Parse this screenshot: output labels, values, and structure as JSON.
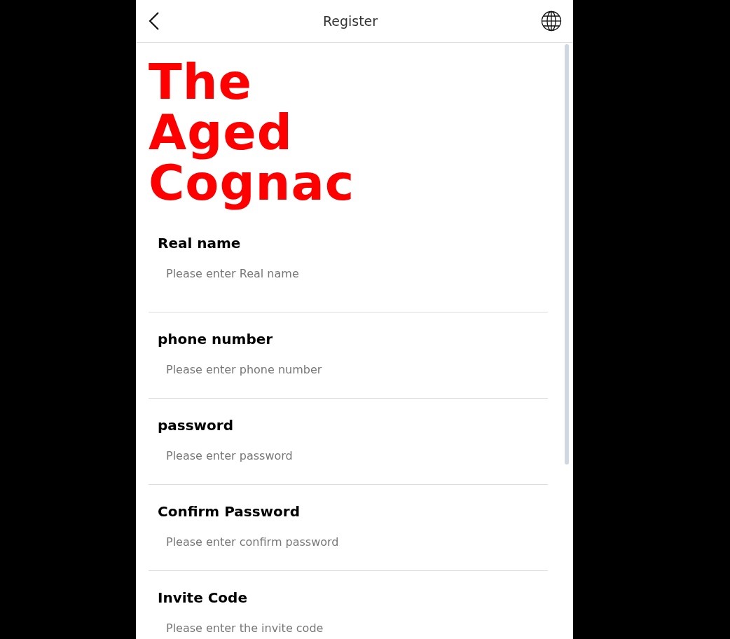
{
  "header": {
    "title": "Register"
  },
  "logo": "The Aged Cognac",
  "fields": [
    {
      "label": "Real name",
      "placeholder": "Please enter Real name"
    },
    {
      "label": "phone number",
      "placeholder": "Please enter phone number"
    },
    {
      "label": "password",
      "placeholder": "Please enter password"
    },
    {
      "label": "Confirm Password",
      "placeholder": "Please enter confirm password"
    },
    {
      "label": "Invite Code",
      "placeholder": "Please enter the invite code"
    }
  ]
}
